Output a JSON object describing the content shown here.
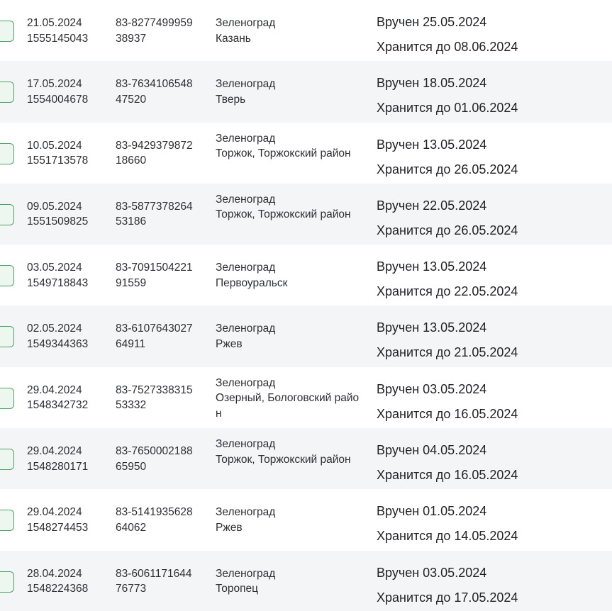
{
  "rows": [
    {
      "date": "21.05.2024",
      "id": "1555145043",
      "track_1": "83-8277499959",
      "track_2": "38937",
      "from": "Зеленоград",
      "to": "Казань",
      "delivered": "Вручен 25.05.2024",
      "stored": "Хранится до 08.06.2024"
    },
    {
      "date": "17.05.2024",
      "id": "1554004678",
      "track_1": "83-7634106548",
      "track_2": "47520",
      "from": "Зеленоград",
      "to": "Тверь",
      "delivered": "Вручен 18.05.2024",
      "stored": "Хранится до 01.06.2024"
    },
    {
      "date": "10.05.2024",
      "id": "1551713578",
      "track_1": "83-9429379872",
      "track_2": "18660",
      "from": "Зеленоград",
      "to": "Торжок, Торжокский район",
      "delivered": "Вручен 13.05.2024",
      "stored": "Хранится до 26.05.2024"
    },
    {
      "date": "09.05.2024",
      "id": "1551509825",
      "track_1": "83-5877378264",
      "track_2": "53186",
      "from": "Зеленоград",
      "to": "Торжок, Торжокский район",
      "delivered": "Вручен 22.05.2024",
      "stored": "Хранится до 26.05.2024"
    },
    {
      "date": "03.05.2024",
      "id": "1549718843",
      "track_1": "83-7091504221",
      "track_2": "91559",
      "from": "Зеленоград",
      "to": "Первоуральск",
      "delivered": "Вручен 13.05.2024",
      "stored": "Хранится до 22.05.2024"
    },
    {
      "date": "02.05.2024",
      "id": "1549344363",
      "track_1": "83-6107643027",
      "track_2": "64911",
      "from": "Зеленоград",
      "to": "Ржев",
      "delivered": "Вручен 13.05.2024",
      "stored": "Хранится до 21.05.2024"
    },
    {
      "date": "29.04.2024",
      "id": "1548342732",
      "track_1": "83-7527338315",
      "track_2": "53332",
      "from": "Зеленоград",
      "to": "Озерный, Бологовский район",
      "delivered": "Вручен 03.05.2024",
      "stored": "Хранится до 16.05.2024"
    },
    {
      "date": "29.04.2024",
      "id": "1548280171",
      "track_1": "83-7650002188",
      "track_2": "65950",
      "from": "Зеленоград",
      "to": "Торжок, Торжокский район",
      "delivered": "Вручен 04.05.2024",
      "stored": "Хранится до 16.05.2024"
    },
    {
      "date": "29.04.2024",
      "id": "1548274453",
      "track_1": "83-5141935628",
      "track_2": "64062",
      "from": "Зеленоград",
      "to": "Ржев",
      "delivered": "Вручен 01.05.2024",
      "stored": "Хранится до 14.05.2024"
    },
    {
      "date": "28.04.2024",
      "id": "1548224368",
      "track_1": "83-6061171644",
      "track_2": "76773",
      "from": "Зеленоград",
      "to": "Торопец",
      "delivered": "Вручен 03.05.2024",
      "stored": "Хранится до 17.05.2024"
    }
  ]
}
